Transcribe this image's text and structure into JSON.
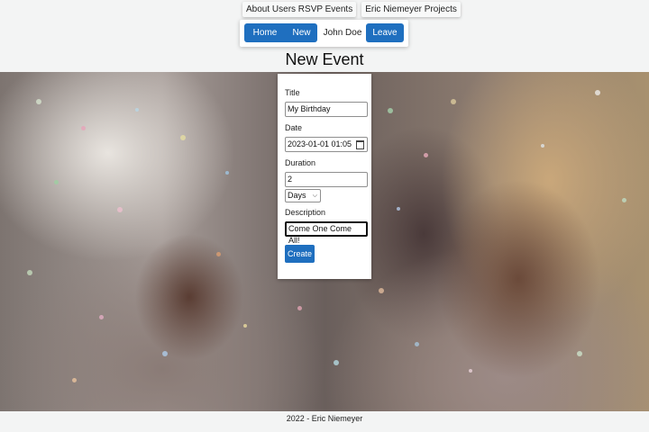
{
  "toplinks": {
    "about": "About Users RSVP Events",
    "projects": "Eric Niemeyer Projects"
  },
  "nav": {
    "home": "Home",
    "new": "New",
    "user": "John Doe",
    "leave": "Leave"
  },
  "page": {
    "title": "New Event"
  },
  "form": {
    "title_label": "Title",
    "title_value": "My Birthday",
    "date_label": "Date",
    "date_value": "2023-01-01 01:05",
    "duration_label": "Duration",
    "duration_value": "2",
    "duration_unit": "Days",
    "description_label": "Description",
    "description_value": "Come One Come All!",
    "submit": "Create"
  },
  "footer": {
    "text": "2022 - Eric Niemeyer"
  },
  "colors": {
    "primary": "#1f6fbf",
    "background": "#f3f4f4"
  },
  "icons": {
    "date": "calendar-icon",
    "select": "chevron-down-icon"
  }
}
